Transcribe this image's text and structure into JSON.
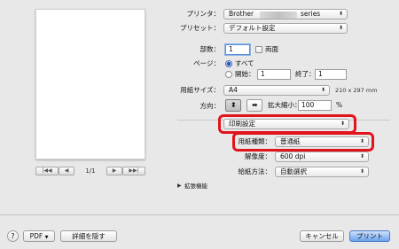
{
  "printer": {
    "label": "プリンタ：",
    "value_prefix": "Brother",
    "value_suffix": "series"
  },
  "preset": {
    "label": "プリセット：",
    "value": "デフォルト設定"
  },
  "copies": {
    "label": "部数：",
    "value": "1",
    "duplex_label": "両面"
  },
  "pages": {
    "label": "ページ：",
    "all_label": "すべて",
    "from_label": "開始：",
    "from_value": "1",
    "to_label": "終了：",
    "to_value": "1"
  },
  "paper_size": {
    "label": "用紙サイズ：",
    "value": "A4",
    "dims": "210 x 297 mm"
  },
  "orientation": {
    "label": "方向：",
    "scale_label": "拡大縮小：",
    "scale_value": "100",
    "scale_unit": "%"
  },
  "section_popup": {
    "value": "印刷設定"
  },
  "media_type": {
    "label": "用紙種類：",
    "value": "普通紙"
  },
  "resolution": {
    "label": "解像度：",
    "value": "600 dpi"
  },
  "feed": {
    "label": "給紙方法：",
    "value": "自動選択"
  },
  "advanced": {
    "label": "拡張機能"
  },
  "preview": {
    "page_indicator": "1/1",
    "first": "|◀◀",
    "prev": "◀",
    "next": "▶",
    "last": "▶▶|"
  },
  "footer": {
    "help": "?",
    "pdf": "PDF",
    "hide_details": "詳細を隠す",
    "cancel": "キャンセル",
    "print": "プリント"
  },
  "colors": {
    "highlight": "#e0141a",
    "primary_button": "#6aa2ee"
  }
}
